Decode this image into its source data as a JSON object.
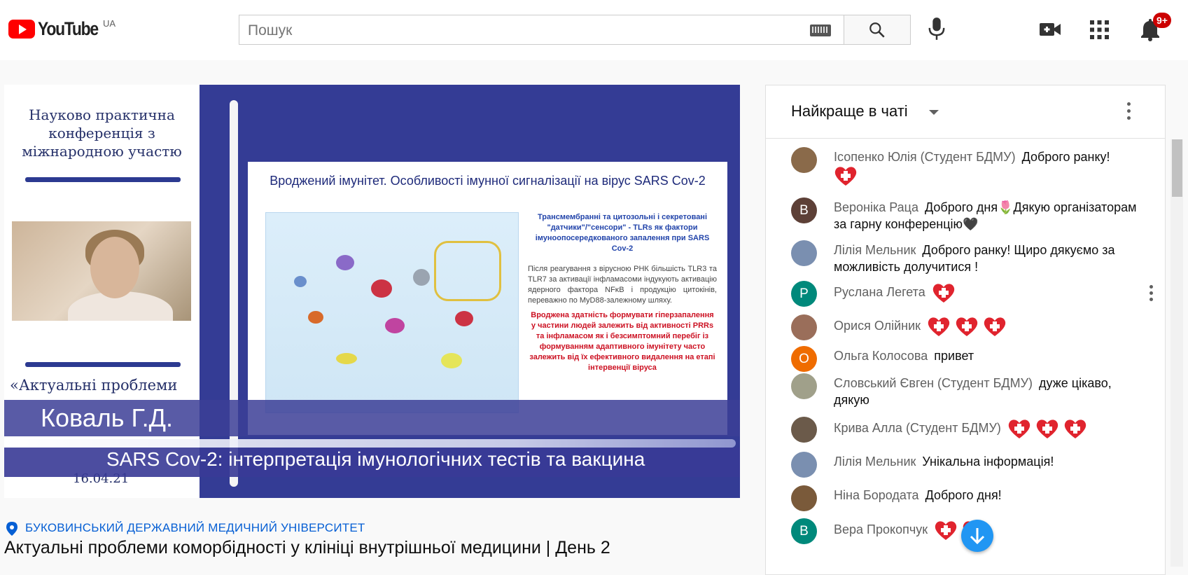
{
  "header": {
    "logo_text": "YouTube",
    "country": "UA",
    "search_placeholder": "Пошук",
    "notifications_badge": "9+"
  },
  "video": {
    "conf_title": "Науково практична конференція з міжнародною участю",
    "conf_sub": "«Актуальні проблеми",
    "date": "16.04.21",
    "slide_title": "Вроджений імунітет. Особливості імунної сигналізації на вірус SARS Cov-2",
    "slide_blue": "Трансмембранні та цитозольні і секретовані \"датчики\"/\"сенсори\" - TLRs як фактори імуноопосередкованого запалення при SARS Cov-2",
    "slide_gray": "Після реагування з вірусною РНК більшість TLR3 та TLR7 за активації інфламасоми індукують активацію ядерного фактора NFκB і продукцію цитокінів, переважно по MyD88-залежному шляху.",
    "slide_red": "Вроджена здатність формувати гіперзапалення у частини людей залежить від активності PRRs та інфламасом як і безсимптомний перебіг із формуванням адаптивного імунітету часто залежить від їх ефективного видалення на етапі інтервенції віруса",
    "speaker_name": "Коваль Г.Д.",
    "topic": "SARS Cov-2: інтерпретація імунологічних тестів та вакцина"
  },
  "info": {
    "location": "БУКОВИНСЬКИЙ ДЕРЖАВНИЙ МЕДИЧНИЙ УНІВЕРСИТЕТ",
    "title": "Актуальні проблеми коморбідності у клініці внутрішньої медицини | День 2"
  },
  "chat": {
    "header": "Найкраще в чаті",
    "messages": [
      {
        "author": "Ісопенко Юлія (Студент БДМУ)",
        "text": "Доброго ранку!",
        "hearts": 1,
        "avatar": "",
        "color": "#8a6a4a"
      },
      {
        "author": "Вероніка Раца",
        "text": "Доброго дня🌷Дякую організаторам за гарну конференцію🖤",
        "hearts": 0,
        "avatar": "В",
        "color": "#5d4037"
      },
      {
        "author": "Лілія Мельник",
        "text": "Доброго ранку! Щиро дякуємо за можливість долучитися !",
        "hearts": 0,
        "avatar": "",
        "color": "#7a8fb0"
      },
      {
        "author": "Руслана Легета",
        "text": "",
        "hearts": 1,
        "avatar": "Р",
        "color": "#00897b"
      },
      {
        "author": "Орися Олійник",
        "text": "",
        "hearts": 3,
        "avatar": "",
        "color": "#9a6e5a"
      },
      {
        "author": "Ольга Колосова",
        "text": "привет",
        "hearts": 0,
        "avatar": "О",
        "color": "#ef6c00"
      },
      {
        "author": "Словський Євген (Студент БДМУ)",
        "text": "дуже цікаво, дякую",
        "hearts": 0,
        "avatar": "",
        "color": "#a0a08a"
      },
      {
        "author": "Крива Алла (Студент БДМУ)",
        "text": "",
        "hearts": 3,
        "avatar": "",
        "color": "#6b5a4a"
      },
      {
        "author": "Лілія Мельник",
        "text": "Унікальна інформація!",
        "hearts": 0,
        "avatar": "",
        "color": "#7a8fb0"
      },
      {
        "author": "Ніна Бородата",
        "text": "Доброго дня!",
        "hearts": 0,
        "avatar": "",
        "color": "#7a5a3a"
      },
      {
        "author": "Вера Прокопчук",
        "text": "",
        "hearts": 2,
        "avatar": "В",
        "color": "#00897b"
      }
    ]
  }
}
